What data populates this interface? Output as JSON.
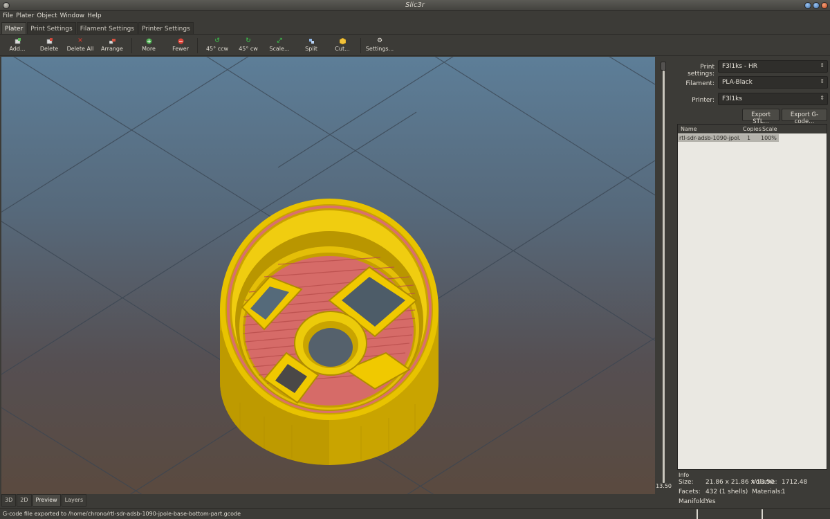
{
  "window": {
    "title": "Slic3r"
  },
  "menu": [
    "File",
    "Plater",
    "Object",
    "Window",
    "Help"
  ],
  "tabs": [
    "Plater",
    "Print Settings",
    "Filament Settings",
    "Printer Settings"
  ],
  "toolbar": {
    "add": "Add...",
    "delete": "Delete",
    "delete_all": "Delete All",
    "arrange": "Arrange",
    "more": "More",
    "fewer": "Fewer",
    "rotate_ccw": "45° ccw",
    "rotate_cw": "45° cw",
    "scale": "Scale...",
    "split": "Split",
    "cut": "Cut...",
    "settings": "Settings..."
  },
  "icons": {
    "add": "plus-brick-icon",
    "delete": "brick-delete-icon",
    "delete_all": "red-x-icon",
    "arrange": "arrange-bricks-icon",
    "more": "green-plus-circle-icon",
    "fewer": "red-minus-circle-icon",
    "rotate_ccw": "rotate-ccw-icon",
    "rotate_cw": "rotate-cw-icon",
    "scale": "arrows-expand-icon",
    "split": "split-shape-icon",
    "cut": "cut-box-icon",
    "settings": "cog-icon"
  },
  "colors": {
    "part_yellow": "#e9c200",
    "infill_red": "#d86a6a",
    "view_top": "#5d7e98",
    "view_bottom": "#5a4a3f"
  },
  "layer_slider": {
    "value": "13.50"
  },
  "view_tabs": [
    "3D",
    "2D",
    "Preview",
    "Layers"
  ],
  "right_panel": {
    "print_settings": {
      "label": "Print settings:",
      "value": "F3l1ks - HR"
    },
    "filament": {
      "label": "Filament:",
      "value": "PLA-Black"
    },
    "printer": {
      "label": "Printer:",
      "value": "F3l1ks"
    },
    "export_stl": "Export STL...",
    "export_gcode": "Export G-code..."
  },
  "object_list": {
    "columns": [
      "Name",
      "Copies",
      "Scale"
    ],
    "rows": [
      {
        "name": "rtl-sdr-adsb-1090-jpol...",
        "copies": "1",
        "scale": "100%"
      }
    ]
  },
  "info": {
    "header": "Info",
    "size_label": "Size:",
    "size_value": "21.86 x 21.86 x 13.50",
    "volume_label": "Volume:",
    "volume_value": "1712.48",
    "facets_label": "Facets:",
    "facets_value": "432 (1 shells)",
    "materials_label": "Materials:",
    "materials_value": "1",
    "manifold_label": "Manifold:",
    "manifold_value": "Yes"
  },
  "status": {
    "message": "G-code file exported to /home/chrono/rtl-sdr-adsb-1090-jpole-base-bottom-part.gcode"
  }
}
